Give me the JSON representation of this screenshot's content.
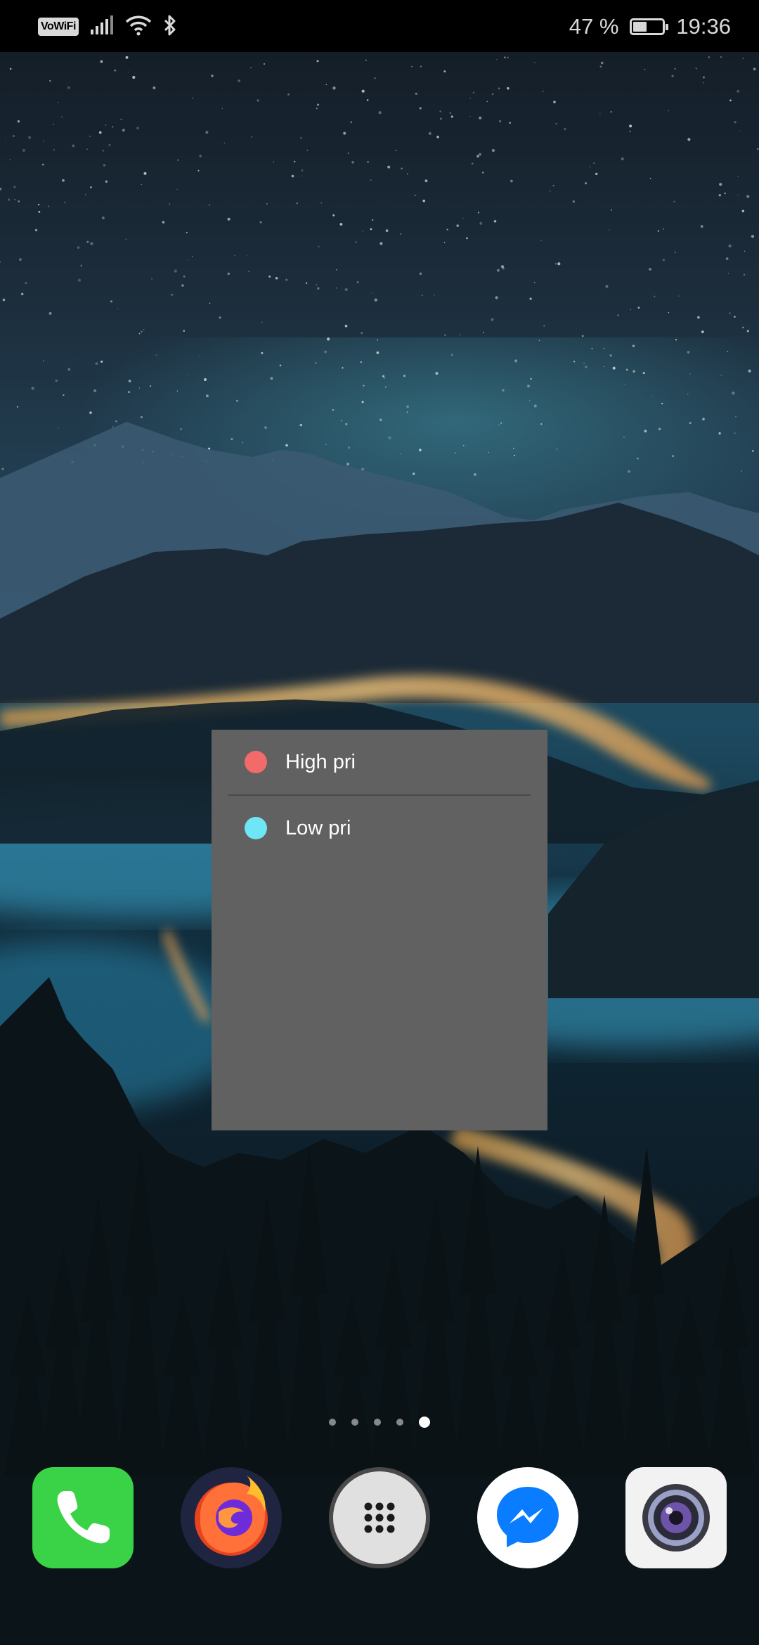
{
  "status_bar": {
    "vowifi_label": "VoWiFi",
    "battery_text": "47 %",
    "battery_level": 0.47,
    "time": "19:36",
    "icons": [
      "signal-icon",
      "wifi-icon",
      "bluetooth-icon",
      "battery-icon"
    ]
  },
  "widget": {
    "items": [
      {
        "label": "High pri",
        "color": "#f26a6a"
      },
      {
        "label": "Low pri",
        "color": "#6ee6f5"
      }
    ]
  },
  "page_indicator": {
    "count": 5,
    "active_index": 4
  },
  "dock": {
    "apps": [
      {
        "name": "phone-icon",
        "color": "#3ad247"
      },
      {
        "name": "firefox-icon",
        "color": "#ff7139"
      },
      {
        "name": "app-drawer-icon",
        "color": "#e0e0e0"
      },
      {
        "name": "messenger-icon",
        "color": "#0a7cff"
      },
      {
        "name": "camera-icon",
        "color": "#f2f2f2"
      }
    ]
  }
}
